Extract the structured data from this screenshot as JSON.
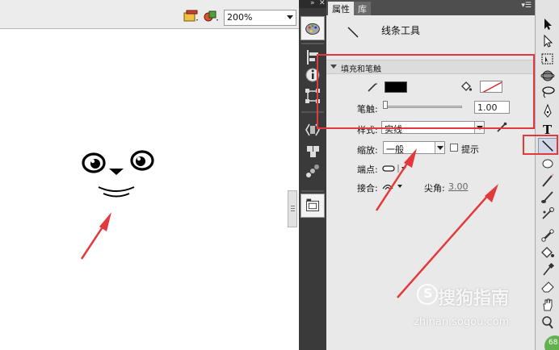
{
  "stage": {
    "zoom": "200%"
  },
  "panel": {
    "tabs": [
      "属性",
      "库"
    ],
    "tool_name": "线条工具",
    "section_title": "填充和笔触",
    "stroke_label": "笔触:",
    "stroke_value": "1.00",
    "style_label": "样式:",
    "style_value": "实线",
    "scale_label": "缩放:",
    "scale_value": "一般",
    "hint_label": "提示",
    "cap_label": "端点:",
    "join_label": "接合:",
    "miter_label": "尖角:",
    "miter_value": "3.00"
  },
  "badge": "68",
  "watermark": {
    "logo": "S",
    "main": "搜狗指南",
    "url": "zhinan.sogou.com"
  },
  "colors": {
    "stroke_color": "#000000",
    "annotation_red": "#e4393c",
    "dock_bg": "#3a3a3a",
    "panel_bg": "#e9e9e9"
  },
  "icons": {
    "edit_bar": [
      "edit-scene-icon",
      "edit-symbol-icon"
    ],
    "dock": [
      "color-palette-icon",
      "align-icon",
      "info-icon",
      "transform-icon",
      "code-snippet-icon",
      "components-icon",
      "motion-presets-icon",
      "library-icon"
    ],
    "tools": [
      "selection-tool-icon",
      "subselection-tool-icon",
      "free-transform-icon",
      "3d-rotation-icon",
      "lasso-icon",
      "pen-icon",
      "text-tool-icon",
      "line-tool-icon",
      "oval-tool-icon",
      "pencil-icon",
      "brush-icon",
      "deco-tool-icon",
      "bone-tool-icon",
      "paint-bucket-icon",
      "eyedropper-icon",
      "eraser-icon",
      "hand-tool-icon",
      "zoom-tool-icon"
    ]
  }
}
